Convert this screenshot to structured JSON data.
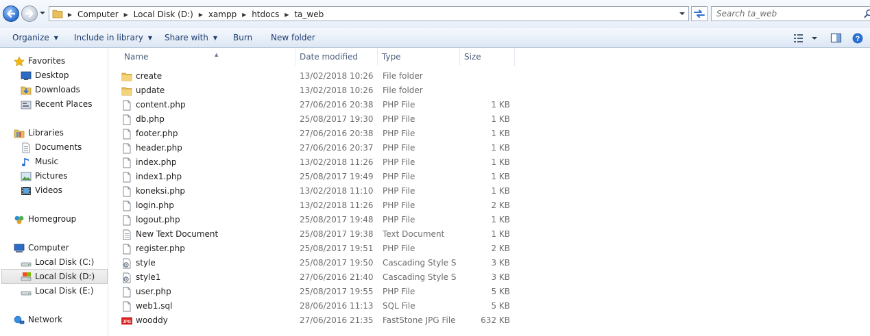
{
  "navigation": {
    "back_icon": "back-arrow-icon",
    "forward_icon": "forward-arrow-icon"
  },
  "address": {
    "breadcrumbs": [
      "Computer",
      "Local Disk (D:)",
      "xampp",
      "htdocs",
      "ta_web"
    ]
  },
  "search": {
    "placeholder": "Search ta_web"
  },
  "toolbar": {
    "organize": "Organize",
    "include_in_library": "Include in library",
    "share_with": "Share with",
    "burn": "Burn",
    "new_folder": "New folder"
  },
  "sidebar": {
    "favorites": {
      "label": "Favorites",
      "items": [
        {
          "label": "Desktop",
          "icon": "desktop-icon"
        },
        {
          "label": "Downloads",
          "icon": "downloads-icon"
        },
        {
          "label": "Recent Places",
          "icon": "recent-places-icon"
        }
      ]
    },
    "libraries": {
      "label": "Libraries",
      "items": [
        {
          "label": "Documents",
          "icon": "documents-icon"
        },
        {
          "label": "Music",
          "icon": "music-icon"
        },
        {
          "label": "Pictures",
          "icon": "pictures-icon"
        },
        {
          "label": "Videos",
          "icon": "videos-icon"
        }
      ]
    },
    "homegroup": {
      "label": "Homegroup"
    },
    "computer": {
      "label": "Computer",
      "items": [
        {
          "label": "Local Disk (C:)",
          "icon": "drive-icon"
        },
        {
          "label": "Local Disk (D:)",
          "icon": "drive-icon",
          "selected": true
        },
        {
          "label": "Local Disk (E:)",
          "icon": "drive-icon"
        }
      ]
    },
    "network": {
      "label": "Network"
    }
  },
  "columns": {
    "name": "Name",
    "date_modified": "Date modified",
    "type": "Type",
    "size": "Size"
  },
  "files": [
    {
      "name": "create",
      "date": "13/02/2018 10:26",
      "type": "File folder",
      "size": "",
      "icon": "folder"
    },
    {
      "name": "update",
      "date": "13/02/2018 10:26",
      "type": "File folder",
      "size": "",
      "icon": "folder"
    },
    {
      "name": "content.php",
      "date": "27/06/2016 20:38",
      "type": "PHP File",
      "size": "1 KB",
      "icon": "file"
    },
    {
      "name": "db.php",
      "date": "25/08/2017 19:30",
      "type": "PHP File",
      "size": "1 KB",
      "icon": "file"
    },
    {
      "name": "footer.php",
      "date": "27/06/2016 20:38",
      "type": "PHP File",
      "size": "1 KB",
      "icon": "file"
    },
    {
      "name": "header.php",
      "date": "27/06/2016 20:37",
      "type": "PHP File",
      "size": "1 KB",
      "icon": "file"
    },
    {
      "name": "index.php",
      "date": "13/02/2018 11:26",
      "type": "PHP File",
      "size": "1 KB",
      "icon": "file"
    },
    {
      "name": "index1.php",
      "date": "25/08/2017 19:49",
      "type": "PHP File",
      "size": "1 KB",
      "icon": "file"
    },
    {
      "name": "koneksi.php",
      "date": "13/02/2018 11:10",
      "type": "PHP File",
      "size": "1 KB",
      "icon": "file"
    },
    {
      "name": "login.php",
      "date": "13/02/2018 11:26",
      "type": "PHP File",
      "size": "2 KB",
      "icon": "file"
    },
    {
      "name": "logout.php",
      "date": "25/08/2017 19:48",
      "type": "PHP File",
      "size": "1 KB",
      "icon": "file"
    },
    {
      "name": "New Text Document",
      "date": "25/08/2017 19:38",
      "type": "Text Document",
      "size": "1 KB",
      "icon": "text"
    },
    {
      "name": "register.php",
      "date": "25/08/2017 19:51",
      "type": "PHP File",
      "size": "2 KB",
      "icon": "file"
    },
    {
      "name": "style",
      "date": "25/08/2017 19:50",
      "type": "Cascading Style S...",
      "size": "3 KB",
      "icon": "css"
    },
    {
      "name": "style1",
      "date": "27/06/2016 21:40",
      "type": "Cascading Style S...",
      "size": "3 KB",
      "icon": "css"
    },
    {
      "name": "user.php",
      "date": "25/08/2017 19:55",
      "type": "PHP File",
      "size": "5 KB",
      "icon": "file"
    },
    {
      "name": "web1.sql",
      "date": "28/06/2016 11:13",
      "type": "SQL File",
      "size": "5 KB",
      "icon": "file"
    },
    {
      "name": "wooddy",
      "date": "27/06/2016 21:35",
      "type": "FastStone JPG File",
      "size": "632 KB",
      "icon": "jpg"
    }
  ]
}
